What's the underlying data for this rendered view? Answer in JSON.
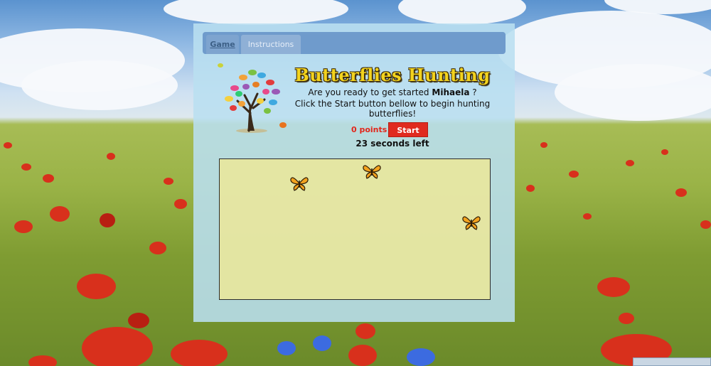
{
  "tabs": [
    {
      "label": "Game",
      "active": true
    },
    {
      "label": "Instructions",
      "active": false
    }
  ],
  "game": {
    "title": "Butterflies Hunting",
    "prompt_prefix": "Are you ready to get started",
    "player_name": "Mihaela",
    "prompt_suffix": "?",
    "instructions": "Click the Start button bellow to begin hunting butterflies!",
    "score_label": "0 points",
    "start_label": "Start",
    "timer_label": "23 seconds left",
    "butterfly_count": 3
  },
  "colors": {
    "accent_red": "#e02a1f",
    "title_yellow": "#f3d31e",
    "panel_blue": "#b9dff0",
    "tab_blue": "#6f9bcc"
  },
  "icons": {
    "tree": "butterfly-tree-icon",
    "butterfly": "butterfly-icon"
  }
}
